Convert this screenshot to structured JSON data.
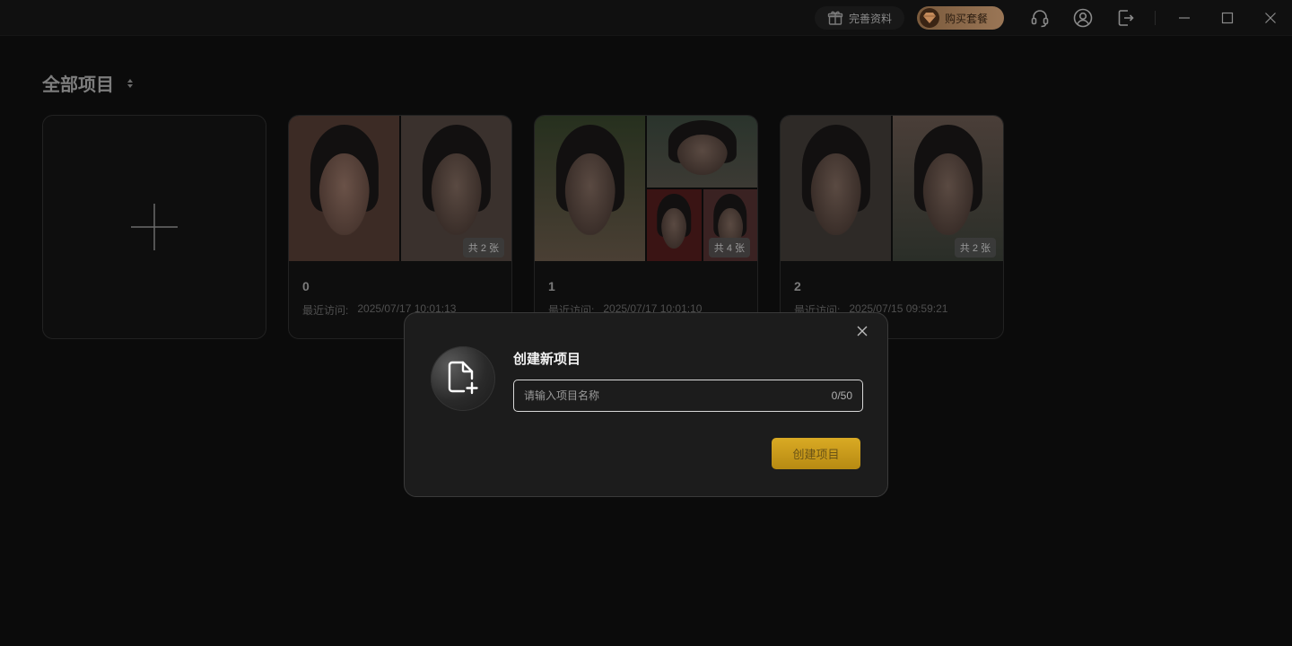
{
  "titlebar": {
    "profile_label": "完善资料",
    "buy_label": "购买套餐",
    "icons": [
      "gift-icon",
      "diamond-icon",
      "headset-icon",
      "user-icon",
      "logout-icon",
      "minimize-icon",
      "maximize-icon",
      "close-icon"
    ]
  },
  "main": {
    "heading": "全部项目",
    "projects": [
      {
        "name": "0",
        "last_visit_label": "最近访问:",
        "last_visit": "2025/07/17 10:01:13",
        "count": "共 2 张"
      },
      {
        "name": "1",
        "last_visit_label": "最近访问:",
        "last_visit": "2025/07/17 10:01:10",
        "count": "共 4 张"
      },
      {
        "name": "2",
        "last_visit_label": "最近访问:",
        "last_visit": "2025/07/15 09:59:21",
        "count": "共 2 张"
      }
    ]
  },
  "modal": {
    "title": "创建新项目",
    "input_placeholder": "请输入项目名称",
    "input_value": "",
    "char_count": "0/50",
    "create_button": "创建项目"
  },
  "colors": {
    "background": "#0b0b0b",
    "modal_bg": "#1c1c1c",
    "accent_gold": "#d9aa24",
    "buy_pill": "#9a7656"
  }
}
